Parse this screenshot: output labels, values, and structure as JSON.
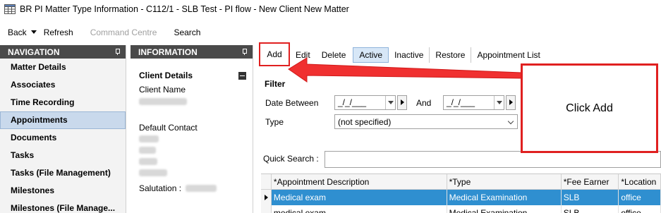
{
  "window": {
    "title": "BR PI Matter Type Information - C112/1 - SLB Test - PI flow - New Client New Matter",
    "app_icon": "table-grid-icon"
  },
  "toolbar": {
    "back": "Back",
    "refresh": "Refresh",
    "command_centre": "Command Centre",
    "search": "Search"
  },
  "navigation": {
    "header": "NAVIGATION",
    "items": [
      {
        "label": "Matter Details"
      },
      {
        "label": "Associates"
      },
      {
        "label": "Time Recording"
      },
      {
        "label": "Appointments",
        "active": true
      },
      {
        "label": "Documents"
      },
      {
        "label": "Tasks"
      },
      {
        "label": "Tasks (File Management)"
      },
      {
        "label": "Milestones"
      },
      {
        "label": "Milestones  (File Manage..."
      }
    ]
  },
  "information": {
    "header": "INFORMATION",
    "section_title": "Client Details",
    "client_name_label": "Client Name",
    "default_contact_label": "Default Contact",
    "salutation_label": "Salutation  :"
  },
  "actions": {
    "add": "Add",
    "edit": "Edit",
    "delete": "Delete",
    "active": "Active",
    "inactive": "Inactive",
    "restore": "Restore",
    "appointment_list": "Appointment List"
  },
  "filter": {
    "title": "Filter",
    "date_between_label": "Date Between",
    "date_from": "_/_/___",
    "and_label": "And",
    "date_to": "_/_/___",
    "type_label": "Type",
    "type_value": "(not specified)"
  },
  "quick_search": {
    "label": "Quick Search :",
    "value": ""
  },
  "grid": {
    "columns": [
      "*Appointment Description",
      "*Type",
      "*Fee Earner",
      "*Location"
    ],
    "rows": [
      {
        "description": "Medical exam",
        "type": "Medical Examination",
        "fee_earner": "SLB",
        "location": "office",
        "selected": true
      },
      {
        "description": "medical exam",
        "type": "Medical Examination",
        "fee_earner": "SLB",
        "location": "office",
        "selected": false
      }
    ]
  },
  "annotation": {
    "callout_text": "Click Add",
    "color": "#e02020"
  },
  "colors": {
    "panel_header": "#4a4a4a",
    "nav_background": "#f3f3f3",
    "selected_row": "#2f8fd0",
    "active_nav": "#c9d9ec"
  }
}
